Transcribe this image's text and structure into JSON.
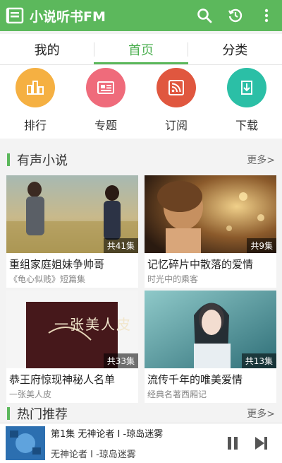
{
  "header": {
    "title": "小说听书FM"
  },
  "tabs": [
    {
      "label": "我的"
    },
    {
      "label": "首页"
    },
    {
      "label": "分类"
    }
  ],
  "quick_links": [
    {
      "label": "排行",
      "icon": "ranking-icon",
      "color": "#f5b042"
    },
    {
      "label": "专题",
      "icon": "topic-icon",
      "color": "#ef6b7b"
    },
    {
      "label": "订阅",
      "icon": "subscribe-icon",
      "color": "#e0573f"
    },
    {
      "label": "下载",
      "icon": "download-icon",
      "color": "#2bbfa6"
    }
  ],
  "sections": [
    {
      "title": "有声小说",
      "more": "更多>"
    },
    {
      "title": "热门推荐",
      "more": "更多>"
    }
  ],
  "cards": [
    {
      "title": "重组家庭姐妹争帅哥",
      "subtitle": "《龟心似贱》短篇集",
      "badge": "共41集"
    },
    {
      "title": "记忆碎片中散落的爱情",
      "subtitle": "时光中的乘客",
      "badge": "共9集"
    },
    {
      "title": "恭王府惊现神秘人名单",
      "subtitle": "一张美人皮",
      "badge": "共33集",
      "cover_text": "一张美人皮"
    },
    {
      "title": "流传千年的唯美爱情",
      "subtitle": "经典名著西厢记",
      "badge": "共13集"
    }
  ],
  "player": {
    "now_playing": "第1集  无神论者 I -琼岛迷雾",
    "track": "无神论者 I -琼岛迷雾"
  },
  "colors": {
    "primary": "#5cb85c"
  }
}
